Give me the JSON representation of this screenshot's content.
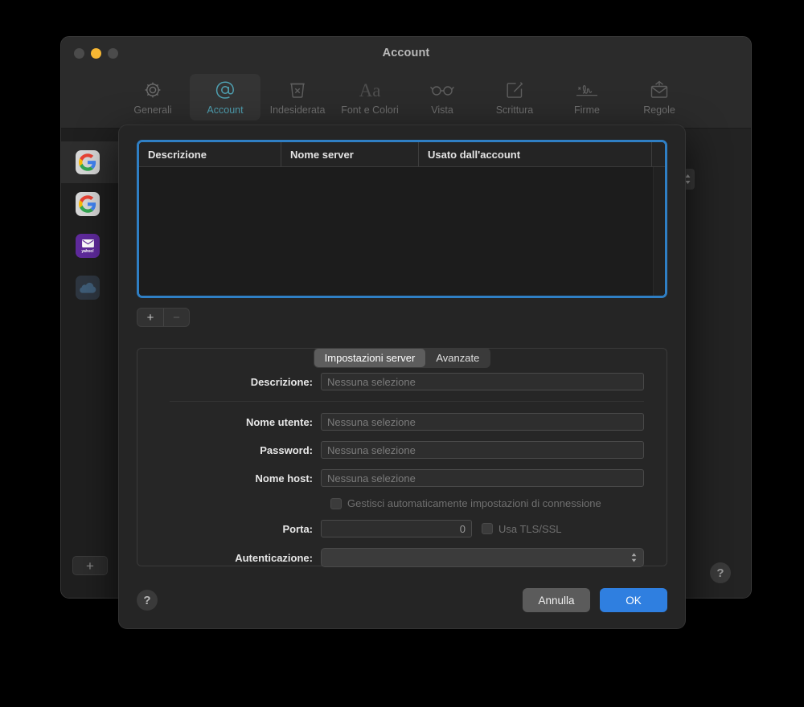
{
  "window": {
    "title": "Account",
    "traffic_lights": [
      {
        "name": "close",
        "color": "#4b4b4b"
      },
      {
        "name": "minimize",
        "color": "#f7b733"
      },
      {
        "name": "zoom",
        "color": "#4b4b4b"
      }
    ]
  },
  "toolbar": {
    "items": [
      {
        "label": "Generali",
        "icon": "gear-icon",
        "selected": false
      },
      {
        "label": "Account",
        "icon": "at-sign-icon",
        "selected": true
      },
      {
        "label": "Indesiderata",
        "icon": "junk-bin-icon",
        "selected": false
      },
      {
        "label": "Font e Colori",
        "icon": "font-aa-icon",
        "selected": false
      },
      {
        "label": "Vista",
        "icon": "glasses-icon",
        "selected": false
      },
      {
        "label": "Scrittura",
        "icon": "compose-pencil-icon",
        "selected": false
      },
      {
        "label": "Firme",
        "icon": "signature-icon",
        "selected": false
      },
      {
        "label": "Regole",
        "icon": "rules-envelope-icon",
        "selected": false
      }
    ],
    "accent_color": "#4f9fb0"
  },
  "accounts_sidebar": {
    "items": [
      {
        "name": "google-account-1",
        "type": "google",
        "selected": true
      },
      {
        "name": "google-account-2",
        "type": "google",
        "selected": false
      },
      {
        "name": "yahoo-account",
        "type": "yahoo",
        "badge": "yahoo!",
        "selected": false
      },
      {
        "name": "icloud-account",
        "type": "icloud",
        "selected": false
      }
    ],
    "add_label": "+"
  },
  "sheet": {
    "table": {
      "columns": [
        "Descrizione",
        "Nome server",
        "Usato dall'account"
      ],
      "rows": [],
      "focus_color": "#2f7fc4"
    },
    "list_controls": {
      "add_label": "+",
      "remove_label": "−"
    },
    "tabs": [
      {
        "label": "Impostazioni server",
        "active": true
      },
      {
        "label": "Avanzate",
        "active": false
      }
    ],
    "form": {
      "descrizione": {
        "label": "Descrizione:",
        "value": "Nessuna selezione"
      },
      "nome_utente": {
        "label": "Nome utente:",
        "value": "Nessuna selezione"
      },
      "password": {
        "label": "Password:",
        "value": "Nessuna selezione"
      },
      "nome_host": {
        "label": "Nome host:",
        "value": "Nessuna selezione"
      },
      "auto_manage": {
        "label": "Gestisci automaticamente impostazioni di connessione",
        "checked": false
      },
      "porta": {
        "label": "Porta:",
        "value": "0"
      },
      "tls": {
        "label": "Usa TLS/SSL",
        "checked": false
      },
      "autenticazione": {
        "label": "Autenticazione:",
        "value": ""
      }
    },
    "footer": {
      "help_label": "?",
      "cancel_label": "Annulla",
      "ok_label": "OK",
      "ok_color": "#2f7fe0"
    }
  },
  "background": {
    "help_label": "?"
  }
}
